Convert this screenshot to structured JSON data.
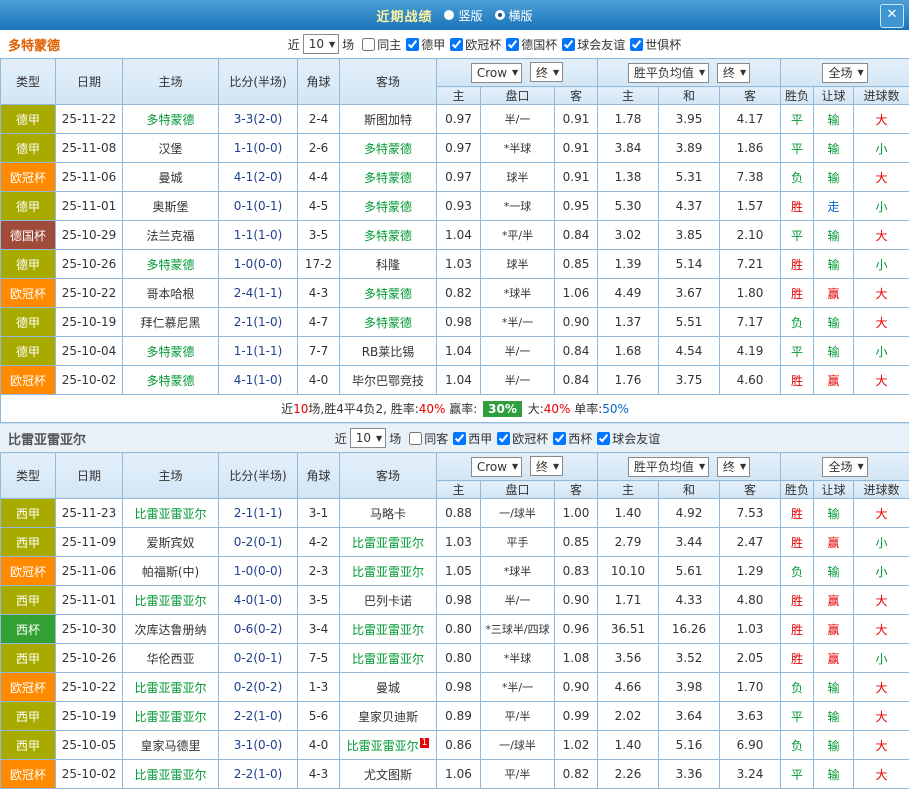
{
  "titlebar": {
    "title": "近期战绩",
    "radio_vertical": "竖版",
    "radio_horizontal": "横版",
    "selected_layout": "横版",
    "close_label": "✕"
  },
  "colors": {
    "team_highlight": "#009933",
    "win_red": "#e60000",
    "green": "#009933",
    "push_blue": "#0066cc",
    "summary_badge_bg": "#2f9e3f"
  },
  "value_colors": {
    "胜": "#e60000",
    "赢": "#e60000",
    "大": "#e60000",
    "平": "#009933",
    "负": "#009933",
    "输": "#009933",
    "小": "#009933",
    "走": "#0066cc"
  },
  "type_colors": {
    "德甲": "#a8aa00",
    "西甲": "#a8aa00",
    "欧冠杯": "#ff8a00",
    "德国杯": "#a04a3a",
    "西杯": "#33a033"
  },
  "sections": [
    {
      "team": "多特蒙德",
      "team_color": "#e05f00",
      "filter": {
        "near_label": "近",
        "count": "10",
        "matches_label": "场",
        "checkboxes": [
          {
            "label": "同主",
            "checked": false
          },
          {
            "label": "德甲",
            "checked": true
          },
          {
            "label": "欧冠杯",
            "checked": true
          },
          {
            "label": "德国杯",
            "checked": true
          },
          {
            "label": "球会友谊",
            "checked": true
          },
          {
            "label": "世俱杯",
            "checked": true
          }
        ]
      },
      "header": {
        "type": "类型",
        "date": "日期",
        "home": "主场",
        "score": "比分(半场)",
        "corner": "角球",
        "away": "客场",
        "odds_source": "Crow",
        "odds_state": "终",
        "odds_home": "主",
        "odds_handicap": "盘口",
        "odds_away": "客",
        "avg_label": "胜平负均值",
        "avg_state": "终",
        "avg_home": "主",
        "avg_draw": "和",
        "avg_away": "客",
        "scope": "全场",
        "result": "胜负",
        "handicap_result": "让球",
        "goals": "进球数"
      },
      "rows": [
        {
          "type": "德甲",
          "date": "25-11-22",
          "home": "多特蒙德",
          "home_hl": true,
          "score": "3-3(2-0)",
          "corner": "2-4",
          "away": "斯图加特",
          "o_home": "0.97",
          "o_hcap": "半/一",
          "o_away": "0.91",
          "a_home": "1.78",
          "a_draw": "3.95",
          "a_away": "4.17",
          "result": "平",
          "hres": "输",
          "goals": "大"
        },
        {
          "type": "德甲",
          "date": "25-11-08",
          "home": "汉堡",
          "score": "1-1(0-0)",
          "corner": "2-6",
          "away": "多特蒙德",
          "away_hl": true,
          "o_home": "0.97",
          "o_hcap": "*半球",
          "o_away": "0.91",
          "a_home": "3.84",
          "a_draw": "3.89",
          "a_away": "1.86",
          "result": "平",
          "hres": "输",
          "goals": "小"
        },
        {
          "type": "欧冠杯",
          "date": "25-11-06",
          "home": "曼城",
          "score": "4-1(2-0)",
          "corner": "4-4",
          "away": "多特蒙德",
          "away_hl": true,
          "o_home": "0.97",
          "o_hcap": "球半",
          "o_away": "0.91",
          "a_home": "1.38",
          "a_draw": "5.31",
          "a_away": "7.38",
          "result": "负",
          "hres": "输",
          "goals": "大"
        },
        {
          "type": "德甲",
          "date": "25-11-01",
          "home": "奥斯堡",
          "score": "0-1(0-1)",
          "corner": "4-5",
          "away": "多特蒙德",
          "away_hl": true,
          "o_home": "0.93",
          "o_hcap": "*一球",
          "o_away": "0.95",
          "a_home": "5.30",
          "a_draw": "4.37",
          "a_away": "1.57",
          "result": "胜",
          "hres": "走",
          "goals": "小"
        },
        {
          "type": "德国杯",
          "date": "25-10-29",
          "home": "法兰克福",
          "score": "1-1(1-0)",
          "corner": "3-5",
          "away": "多特蒙德",
          "away_hl": true,
          "o_home": "1.04",
          "o_hcap": "*平/半",
          "o_away": "0.84",
          "a_home": "3.02",
          "a_draw": "3.85",
          "a_away": "2.10",
          "result": "平",
          "hres": "输",
          "goals": "大"
        },
        {
          "type": "德甲",
          "date": "25-10-26",
          "home": "多特蒙德",
          "home_hl": true,
          "score": "1-0(0-0)",
          "corner": "17-2",
          "away": "科隆",
          "o_home": "1.03",
          "o_hcap": "球半",
          "o_away": "0.85",
          "a_home": "1.39",
          "a_draw": "5.14",
          "a_away": "7.21",
          "result": "胜",
          "hres": "输",
          "goals": "小"
        },
        {
          "type": "欧冠杯",
          "date": "25-10-22",
          "home": "哥本哈根",
          "score": "2-4(1-1)",
          "corner": "4-3",
          "away": "多特蒙德",
          "away_hl": true,
          "o_home": "0.82",
          "o_hcap": "*球半",
          "o_away": "1.06",
          "a_home": "4.49",
          "a_draw": "3.67",
          "a_away": "1.80",
          "result": "胜",
          "hres": "赢",
          "goals": "大"
        },
        {
          "type": "德甲",
          "date": "25-10-19",
          "home": "拜仁慕尼黑",
          "score": "2-1(1-0)",
          "corner": "4-7",
          "away": "多特蒙德",
          "away_hl": true,
          "o_home": "0.98",
          "o_hcap": "*半/一",
          "o_away": "0.90",
          "a_home": "1.37",
          "a_draw": "5.51",
          "a_away": "7.17",
          "result": "负",
          "hres": "输",
          "goals": "大"
        },
        {
          "type": "德甲",
          "date": "25-10-04",
          "home": "多特蒙德",
          "home_hl": true,
          "score": "1-1(1-1)",
          "corner": "7-7",
          "away": "RB莱比锡",
          "o_home": "1.04",
          "o_hcap": "半/一",
          "o_away": "0.84",
          "a_home": "1.68",
          "a_draw": "4.54",
          "a_away": "4.19",
          "result": "平",
          "hres": "输",
          "goals": "小"
        },
        {
          "type": "欧冠杯",
          "date": "25-10-02",
          "home": "多特蒙德",
          "home_hl": true,
          "score": "4-1(1-0)",
          "corner": "4-0",
          "away": "毕尔巴鄂竞技",
          "o_home": "1.04",
          "o_hcap": "半/一",
          "o_away": "0.84",
          "a_home": "1.76",
          "a_draw": "3.75",
          "a_away": "4.60",
          "result": "胜",
          "hres": "赢",
          "goals": "大"
        }
      ],
      "summary": [
        {
          "t": "近",
          "c": "#333333"
        },
        {
          "t": "10",
          "c": "#e60000"
        },
        {
          "t": "场,胜4平4负2, 胜率:",
          "c": "#333333"
        },
        {
          "t": "40%",
          "c": "#e60000"
        },
        {
          "t": " 赢率: ",
          "c": "#333333"
        },
        {
          "t": "30%",
          "c": "#ffffff",
          "bg": "#2f9e3f"
        },
        {
          "t": " 大:",
          "c": "#333333"
        },
        {
          "t": "40%",
          "c": "#e60000"
        },
        {
          "t": " 单率:",
          "c": "#333333"
        },
        {
          "t": "50%",
          "c": "#0066cc"
        }
      ]
    },
    {
      "team": "比雷亚雷亚尔",
      "team_color": "#555555",
      "filter": {
        "near_label": "近",
        "count": "10",
        "matches_label": "场",
        "checkboxes": [
          {
            "label": "同客",
            "checked": false
          },
          {
            "label": "西甲",
            "checked": true
          },
          {
            "label": "欧冠杯",
            "checked": true
          },
          {
            "label": "西杯",
            "checked": true
          },
          {
            "label": "球会友谊",
            "checked": true
          }
        ]
      },
      "header": {
        "type": "类型",
        "date": "日期",
        "home": "主场",
        "score": "比分(半场)",
        "corner": "角球",
        "away": "客场",
        "odds_source": "Crow",
        "odds_state": "终",
        "odds_home": "主",
        "odds_handicap": "盘口",
        "odds_away": "客",
        "avg_label": "胜平负均值",
        "avg_state": "终",
        "avg_home": "主",
        "avg_draw": "和",
        "avg_away": "客",
        "scope": "全场",
        "result": "胜负",
        "handicap_result": "让球",
        "goals": "进球数"
      },
      "rows": [
        {
          "type": "西甲",
          "date": "25-11-23",
          "home": "比雷亚雷亚尔",
          "home_hl": true,
          "score": "2-1(1-1)",
          "corner": "3-1",
          "away": "马略卡",
          "o_home": "0.88",
          "o_hcap": "一/球半",
          "o_away": "1.00",
          "a_home": "1.40",
          "a_draw": "4.92",
          "a_away": "7.53",
          "result": "胜",
          "hres": "输",
          "goals": "大"
        },
        {
          "type": "西甲",
          "date": "25-11-09",
          "home": "爱斯宾奴",
          "score": "0-2(0-1)",
          "corner": "4-2",
          "away": "比雷亚雷亚尔",
          "away_hl": true,
          "o_home": "1.03",
          "o_hcap": "平手",
          "o_away": "0.85",
          "a_home": "2.79",
          "a_draw": "3.44",
          "a_away": "2.47",
          "result": "胜",
          "hres": "赢",
          "goals": "小"
        },
        {
          "type": "欧冠杯",
          "date": "25-11-06",
          "home": "帕福斯(中)",
          "score": "1-0(0-0)",
          "corner": "2-3",
          "away": "比雷亚雷亚尔",
          "away_hl": true,
          "o_home": "1.05",
          "o_hcap": "*球半",
          "o_away": "0.83",
          "a_home": "10.10",
          "a_draw": "5.61",
          "a_away": "1.29",
          "result": "负",
          "hres": "输",
          "goals": "小"
        },
        {
          "type": "西甲",
          "date": "25-11-01",
          "home": "比雷亚雷亚尔",
          "home_hl": true,
          "score": "4-0(1-0)",
          "corner": "3-5",
          "away": "巴列卡诺",
          "o_home": "0.98",
          "o_hcap": "半/一",
          "o_away": "0.90",
          "a_home": "1.71",
          "a_draw": "4.33",
          "a_away": "4.80",
          "result": "胜",
          "hres": "赢",
          "goals": "大"
        },
        {
          "type": "西杯",
          "date": "25-10-30",
          "home": "次库达鲁册纳",
          "score": "0-6(0-2)",
          "corner": "3-4",
          "away": "比雷亚雷亚尔",
          "away_hl": true,
          "o_home": "0.80",
          "o_hcap": "*三球半/四球",
          "o_away": "0.96",
          "a_home": "36.51",
          "a_draw": "16.26",
          "a_away": "1.03",
          "result": "胜",
          "hres": "赢",
          "goals": "大"
        },
        {
          "type": "西甲",
          "date": "25-10-26",
          "home": "华伦西亚",
          "score": "0-2(0-1)",
          "corner": "7-5",
          "away": "比雷亚雷亚尔",
          "away_hl": true,
          "o_home": "0.80",
          "o_hcap": "*半球",
          "o_away": "1.08",
          "a_home": "3.56",
          "a_draw": "3.52",
          "a_away": "2.05",
          "result": "胜",
          "hres": "赢",
          "goals": "小"
        },
        {
          "type": "欧冠杯",
          "date": "25-10-22",
          "home": "比雷亚雷亚尔",
          "home_hl": true,
          "score": "0-2(0-2)",
          "corner": "1-3",
          "away": "曼城",
          "o_home": "0.98",
          "o_hcap": "*半/一",
          "o_away": "0.90",
          "a_home": "4.66",
          "a_draw": "3.98",
          "a_away": "1.70",
          "result": "负",
          "hres": "输",
          "goals": "大"
        },
        {
          "type": "西甲",
          "date": "25-10-19",
          "home": "比雷亚雷亚尔",
          "home_hl": true,
          "score": "2-2(1-0)",
          "corner": "5-6",
          "away": "皇家贝迪斯",
          "o_home": "0.89",
          "o_hcap": "平/半",
          "o_away": "0.99",
          "a_home": "2.02",
          "a_draw": "3.64",
          "a_away": "3.63",
          "result": "平",
          "hres": "输",
          "goals": "大"
        },
        {
          "type": "西甲",
          "date": "25-10-05",
          "home": "皇家马德里",
          "score": "3-1(0-0)",
          "corner": "4-0",
          "away": "比雷亚雷亚尔",
          "away_hl": true,
          "away_sup": "1",
          "o_home": "0.86",
          "o_hcap": "一/球半",
          "o_away": "1.02",
          "a_home": "1.40",
          "a_draw": "5.16",
          "a_away": "6.90",
          "result": "负",
          "hres": "输",
          "goals": "大"
        },
        {
          "type": "欧冠杯",
          "date": "25-10-02",
          "home": "比雷亚雷亚尔",
          "home_hl": true,
          "score": "2-2(1-0)",
          "corner": "4-3",
          "away": "尤文图斯",
          "o_home": "1.06",
          "o_hcap": "平/半",
          "o_away": "0.82",
          "a_home": "2.26",
          "a_draw": "3.36",
          "a_away": "3.24",
          "result": "平",
          "hres": "输",
          "goals": "大"
        }
      ],
      "summary": null
    }
  ]
}
